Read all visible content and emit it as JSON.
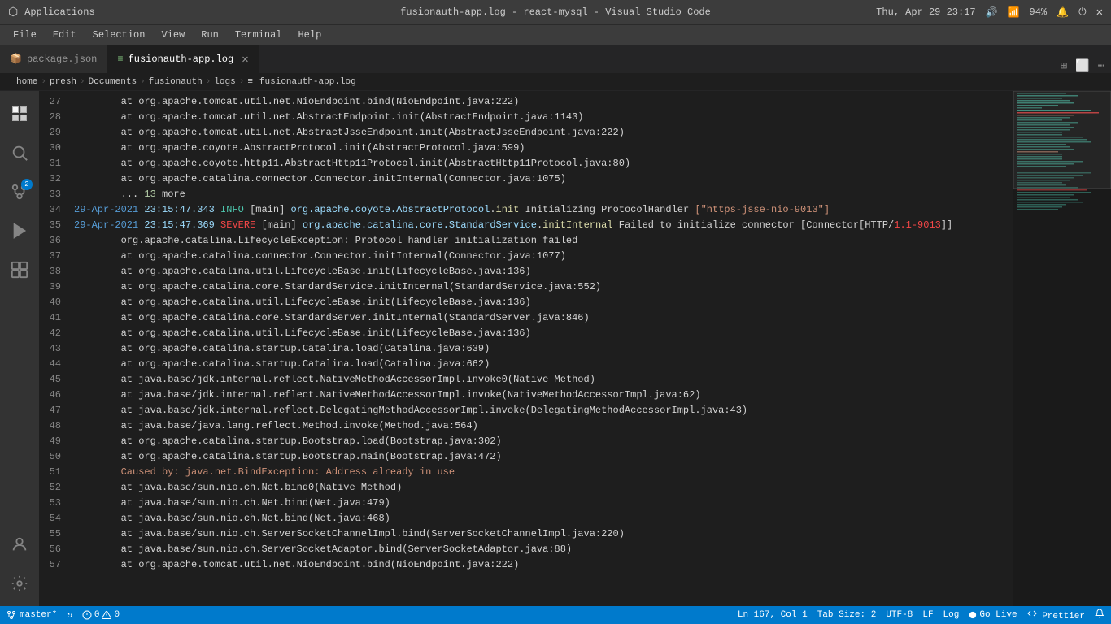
{
  "titlebar": {
    "app_icon": "⬡",
    "close_icon": "✕",
    "title": "fusionauth-app.log - react-mysql - Visual Studio Code",
    "maximize_icon": "⬜",
    "system_time": "Thu, Apr 29   23:17",
    "volume_icon": "🔊",
    "wifi_icon": "📶",
    "battery": "94%",
    "notification_icon": "🔔",
    "power_icon": "⏻",
    "app_label": "Applications"
  },
  "menubar": {
    "items": [
      "File",
      "Edit",
      "Selection",
      "View",
      "Run",
      "Terminal",
      "Help"
    ]
  },
  "tabs": {
    "inactive_tab": {
      "icon": "📦",
      "label": "package.json"
    },
    "active_tab": {
      "icon": "📄",
      "label": "fusionauth-app.log",
      "close": "✕"
    },
    "actions": [
      "⊞",
      "⬜",
      "⋯"
    ]
  },
  "breadcrumb": {
    "items": [
      "home",
      "presh",
      "Documents",
      "fusionauth",
      "logs",
      "fusionauth-app.log"
    ]
  },
  "activitybar": {
    "icons": [
      {
        "name": "explorer",
        "symbol": "⧉",
        "active": true
      },
      {
        "name": "search",
        "symbol": "🔍",
        "active": false
      },
      {
        "name": "source-control",
        "symbol": "⑂",
        "badge": "2",
        "active": false
      },
      {
        "name": "run",
        "symbol": "▷",
        "active": false
      },
      {
        "name": "extensions",
        "symbol": "⊞",
        "active": false
      }
    ],
    "bottom_icons": [
      {
        "name": "account",
        "symbol": "👤"
      },
      {
        "name": "settings",
        "symbol": "⚙"
      }
    ]
  },
  "editor": {
    "lines": [
      {
        "num": "27",
        "indent": "        ",
        "content": "at org.apache.tomcat.util.net.NioEndpoint.bind(NioEndpoint.java:222)",
        "type": "normal"
      },
      {
        "num": "28",
        "indent": "        ",
        "content": "at org.apache.tomcat.util.net.AbstractEndpoint.init(AbstractEndpoint.java:1143)",
        "type": "normal"
      },
      {
        "num": "29",
        "indent": "        ",
        "content": "at org.apache.tomcat.util.net.AbstractJsseEndpoint.init(AbstractJsseEndpoint.java:222)",
        "type": "normal"
      },
      {
        "num": "30",
        "indent": "        ",
        "content": "at org.apache.coyote.AbstractProtocol.init(AbstractProtocol.java:599)",
        "type": "normal"
      },
      {
        "num": "31",
        "indent": "        ",
        "content": "at org.apache.coyote.http11.AbstractHttp11Protocol.init(AbstractHttp11Protocol.java:80)",
        "type": "normal"
      },
      {
        "num": "32",
        "indent": "        ",
        "content": "at org.apache.catalina.connector.Connector.initInternal(Connector.java:1075)",
        "type": "normal"
      },
      {
        "num": "33",
        "indent": "        ",
        "content": "... 13 more",
        "type": "dots"
      },
      {
        "num": "34",
        "indent": "",
        "content": "29-Apr-2021 23:15:47.343 INFO [main] org.apache.coyote.AbstractProtocol.init Initializing ProtocolHandler [\"https-jsse-nio-9013\"]",
        "type": "info"
      },
      {
        "num": "35",
        "indent": "",
        "content": "29-Apr-2021 23:15:47.369 SEVERE [main] org.apache.catalina.core.StandardService.initInternal Failed to initialize connector [Connector[HTTP/1.1-9013]]",
        "type": "severe"
      },
      {
        "num": "36",
        "indent": "        ",
        "content": "org.apache.catalina.LifecycleException: Protocol handler initialization failed",
        "type": "error"
      },
      {
        "num": "37",
        "indent": "        ",
        "content": "at org.apache.catalina.connector.Connector.initInternal(Connector.java:1077)",
        "type": "normal"
      },
      {
        "num": "38",
        "indent": "        ",
        "content": "at org.apache.catalina.util.LifecycleBase.init(LifecycleBase.java:136)",
        "type": "normal"
      },
      {
        "num": "39",
        "indent": "        ",
        "content": "at org.apache.catalina.core.StandardService.initInternal(StandardService.java:552)",
        "type": "normal"
      },
      {
        "num": "40",
        "indent": "        ",
        "content": "at org.apache.catalina.util.LifecycleBase.init(LifecycleBase.java:136)",
        "type": "normal"
      },
      {
        "num": "41",
        "indent": "        ",
        "content": "at org.apache.catalina.core.StandardServer.initInternal(StandardServer.java:846)",
        "type": "normal"
      },
      {
        "num": "42",
        "indent": "        ",
        "content": "at org.apache.catalina.util.LifecycleBase.init(LifecycleBase.java:136)",
        "type": "normal"
      },
      {
        "num": "43",
        "indent": "        ",
        "content": "at org.apache.catalina.startup.Catalina.load(Catalina.java:639)",
        "type": "normal"
      },
      {
        "num": "44",
        "indent": "        ",
        "content": "at org.apache.catalina.startup.Catalina.load(Catalina.java:662)",
        "type": "normal"
      },
      {
        "num": "45",
        "indent": "        ",
        "content": "at java.base/jdk.internal.reflect.NativeMethodAccessorImpl.invoke0(Native Method)",
        "type": "normal"
      },
      {
        "num": "46",
        "indent": "        ",
        "content": "at java.base/jdk.internal.reflect.NativeMethodAccessorImpl.invoke(NativeMethodAccessorImpl.java:62)",
        "type": "normal"
      },
      {
        "num": "47",
        "indent": "        ",
        "content": "at java.base/jdk.internal.reflect.DelegatingMethodAccessorImpl.invoke(DelegatingMethodAccessorImpl.java:43)",
        "type": "normal"
      },
      {
        "num": "48",
        "indent": "        ",
        "content": "at java.base/java.lang.reflect.Method.invoke(Method.java:564)",
        "type": "normal"
      },
      {
        "num": "49",
        "indent": "        ",
        "content": "at org.apache.catalina.startup.Bootstrap.load(Bootstrap.java:302)",
        "type": "normal"
      },
      {
        "num": "50",
        "indent": "        ",
        "content": "at org.apache.catalina.startup.Bootstrap.main(Bootstrap.java:472)",
        "type": "normal"
      },
      {
        "num": "51",
        "indent": "        ",
        "content": "Caused by: java.net.BindException: Address already in use",
        "type": "cause"
      },
      {
        "num": "52",
        "indent": "        ",
        "content": "at java.base/sun.nio.ch.Net.bind0(Native Method)",
        "type": "normal"
      },
      {
        "num": "53",
        "indent": "        ",
        "content": "at java.base/sun.nio.ch.Net.bind(Net.java:479)",
        "type": "normal"
      },
      {
        "num": "54",
        "indent": "        ",
        "content": "at java.base/sun.nio.ch.Net.bind(Net.java:468)",
        "type": "normal"
      },
      {
        "num": "55",
        "indent": "        ",
        "content": "at java.base/sun.nio.ch.ServerSocketChannelImpl.bind(ServerSocketChannelImpl.java:220)",
        "type": "normal"
      },
      {
        "num": "56",
        "indent": "        ",
        "content": "at java.base/sun.nio.ch.ServerSocketAdaptor.bind(ServerSocketAdaptor.java:88)",
        "type": "normal"
      },
      {
        "num": "57",
        "indent": "        ",
        "content": "at org.apache.tomcat.util.net.NioEndpoint.bind(NioEndpoint.java:222)",
        "type": "normal"
      }
    ]
  },
  "statusbar": {
    "branch": "master*",
    "sync": "↻",
    "errors": "0",
    "warnings": "0",
    "position": "Ln 167, Col 1",
    "tab_size": "Tab Size: 2",
    "encoding": "UTF-8",
    "eol": "LF",
    "type": "Log",
    "go_live": "Go Live",
    "prettier": "Prettier"
  },
  "colors": {
    "titlebar_bg": "#3c3c3c",
    "menubar_bg": "#3c3c3c",
    "editor_bg": "#1e1e1e",
    "activitybar_bg": "#333333",
    "statusbar_bg": "#007acc",
    "tab_active_bg": "#1e1e1e",
    "tab_inactive_bg": "#2d2d2d",
    "log_info_color": "#4ec9b0",
    "log_severe_color": "#f44747",
    "log_cause_color": "#ce9178"
  }
}
